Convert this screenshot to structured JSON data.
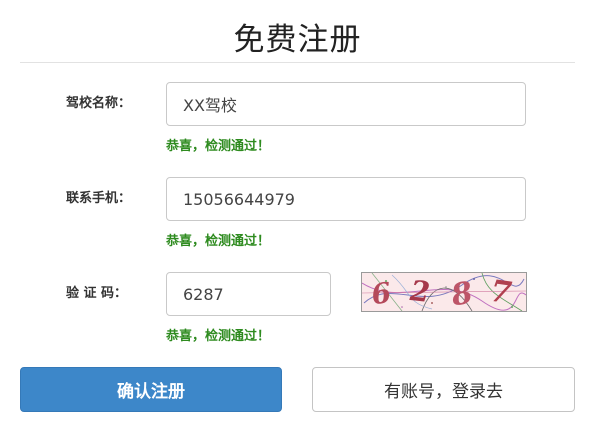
{
  "page": {
    "title": "免费注册"
  },
  "form": {
    "school_name": {
      "label": "驾校名称：",
      "value": "XX驾校",
      "hint": "恭喜，检测通过！"
    },
    "phone": {
      "label": "联系手机：",
      "value": "15056644979",
      "hint": "恭喜，检测通过！"
    },
    "captcha": {
      "label": "验 证 码：",
      "value": "6287",
      "hint": "恭喜，检测通过！",
      "image_chars": [
        "6",
        "2",
        "8",
        "7"
      ],
      "image_colors": [
        "#b4495a",
        "#a6384b",
        "#bd5568",
        "#b0404f"
      ]
    }
  },
  "buttons": {
    "submit_label": "确认注册",
    "login_label": "有账号，登录去"
  },
  "colors": {
    "primary": "#3d87c9",
    "success": "#2e8b1f"
  }
}
